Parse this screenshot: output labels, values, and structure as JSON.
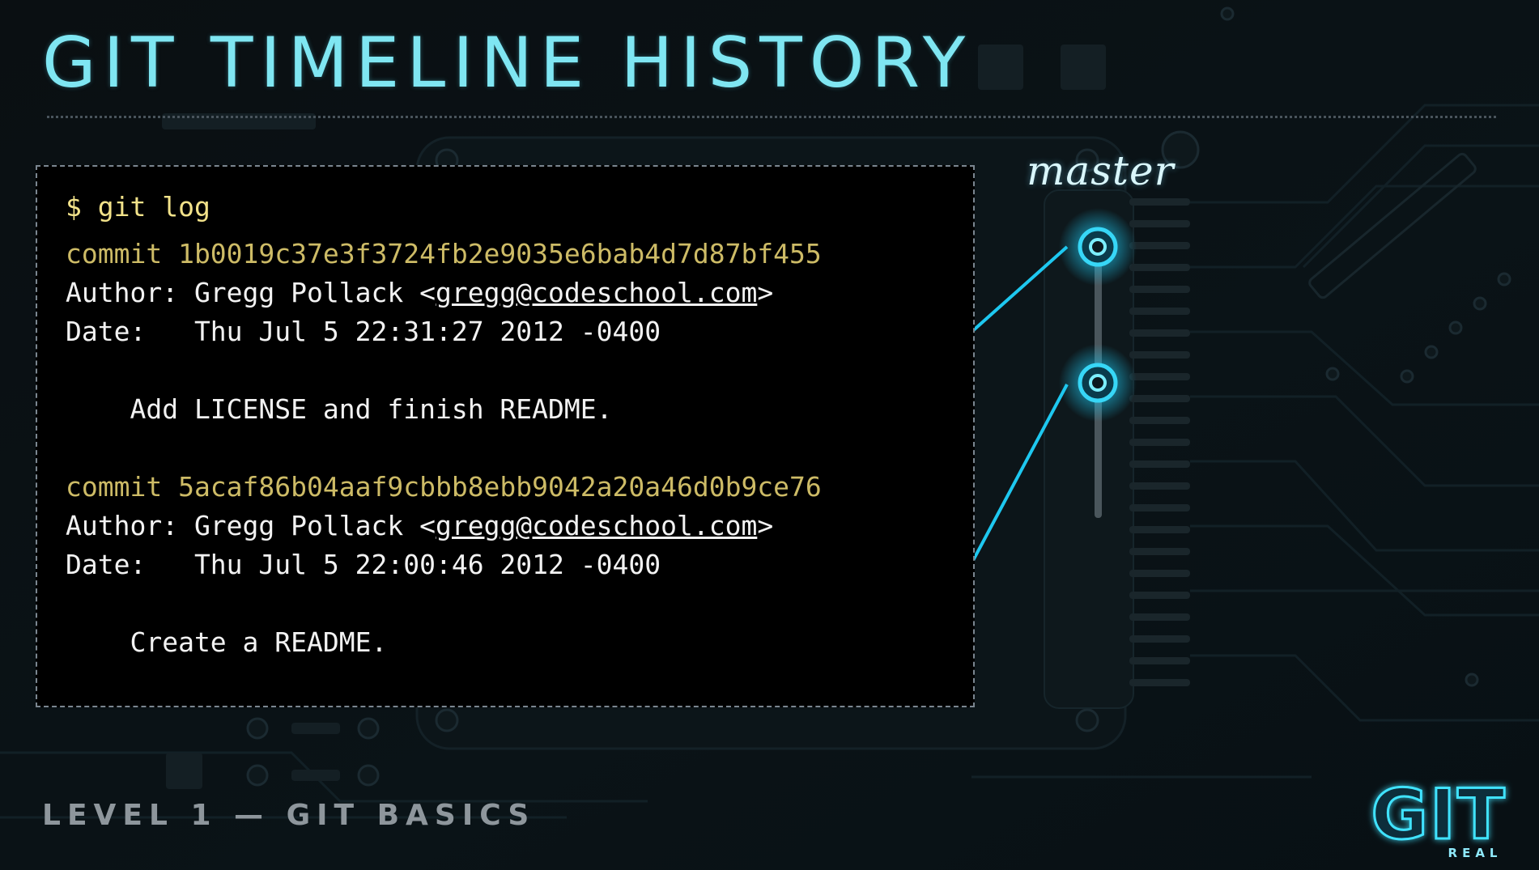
{
  "slide": {
    "title": "GIT TIMELINE HISTORY",
    "footer": "LEVEL 1 — GIT BASICS"
  },
  "terminal": {
    "prompt": "$ git log",
    "commits": [
      {
        "commit_line": "commit 1b0019c37e3f3724fb2e9035e6bab4d7d87bf455",
        "author_prefix": "Author: Gregg Pollack <",
        "author_email": "gregg@codeschool.com",
        "author_suffix": ">",
        "date_line": "Date:   Thu Jul 5 22:31:27 2012 -0400",
        "message": "    Add LICENSE and finish README."
      },
      {
        "commit_line": "commit 5acaf86b04aaf9cbbb8ebb9042a20a46d0b9ce76",
        "author_prefix": "Author: Gregg Pollack <",
        "author_email": "gregg@codeschool.com",
        "author_suffix": ">",
        "date_line": "Date:   Thu Jul 5 22:00:46 2012 -0400",
        "message": "    Create a README."
      }
    ]
  },
  "branch": {
    "label": "master"
  },
  "logo": {
    "text": "GIT",
    "subtext": "REAL"
  },
  "colors": {
    "title": "#7fe6f2",
    "accent": "#1ec8f0",
    "commit_hash": "#cdbb66",
    "prompt": "#f2e28a"
  }
}
